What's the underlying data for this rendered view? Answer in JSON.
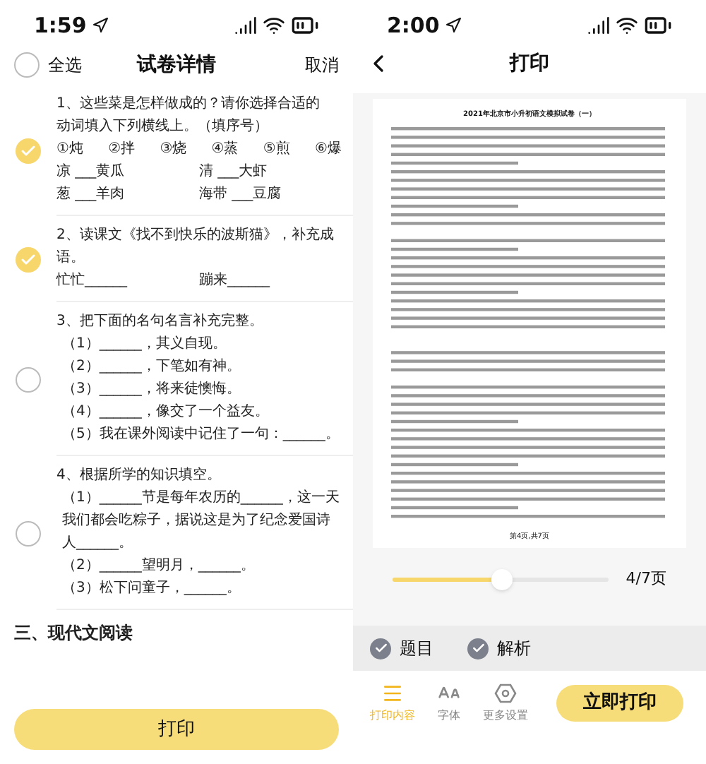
{
  "left": {
    "status_bar": {
      "time": "1:59"
    },
    "header": {
      "select_all": {
        "label": "全选",
        "checked": false
      },
      "title": "试卷详情",
      "cancel": "取消"
    },
    "questions": [
      {
        "selected": true,
        "lines": [
          {
            "kind": "text",
            "text": "1、这些菜是怎样做成的？请你选择合适的"
          },
          {
            "kind": "text",
            "text": "动词填入下列横线上。（填序号）"
          },
          {
            "kind": "cols",
            "cells": [
              "①炖",
              "②拌",
              "③烧",
              "④蒸",
              "⑤煎",
              "⑥爆"
            ]
          },
          {
            "kind": "cols",
            "cells": [
              "凉 ___黄瓜",
              "清 ___大虾"
            ]
          },
          {
            "kind": "cols",
            "cells": [
              "葱 ___羊肉",
              "海带 ___豆腐"
            ]
          }
        ]
      },
      {
        "selected": true,
        "lines": [
          {
            "kind": "text",
            "text": "2、读课文《找不到快乐的波斯猫》，补充成语。"
          },
          {
            "kind": "cols",
            "cells": [
              "忙忙______",
              "蹦来______"
            ]
          }
        ]
      },
      {
        "selected": false,
        "lines": [
          {
            "kind": "text",
            "text": "3、把下面的名句名言补充完整。"
          },
          {
            "kind": "sub",
            "text": "（1）______，其义自现。"
          },
          {
            "kind": "sub",
            "text": "（2）______，下笔如有神。"
          },
          {
            "kind": "sub",
            "text": "（3）______，将来徒懊悔。"
          },
          {
            "kind": "sub",
            "text": "（4）______，像交了一个益友。"
          },
          {
            "kind": "sub",
            "text": "（5）我在课外阅读中记住了一句：______。"
          }
        ]
      },
      {
        "selected": false,
        "lines": [
          {
            "kind": "text",
            "text": "4、根据所学的知识填空。"
          },
          {
            "kind": "sub",
            "text": "（1）______节是每年农历的______，这一天我们都会吃粽子，据说这是为了纪念爱国诗人______。"
          },
          {
            "kind": "sub",
            "text": "（2）______望明月，______。"
          },
          {
            "kind": "sub",
            "text": "（3）松下问童子，______。"
          }
        ]
      }
    ],
    "section": "三、现代文阅读",
    "print_button": "打印"
  },
  "right": {
    "status_bar": {
      "time": "2:00"
    },
    "nav": {
      "title": "打印"
    },
    "preview": {
      "title": "2021年北京市小升初语文模拟试卷（一）",
      "footer": "第4页,共7页"
    },
    "pager": {
      "level": 0.5,
      "reading": "4/7页"
    },
    "options": [
      {
        "label": "题目",
        "checked": true
      },
      {
        "label": "解析",
        "checked": true
      }
    ],
    "tabs": [
      {
        "kind": "content",
        "label": "打印内容",
        "selected": true
      },
      {
        "kind": "font",
        "label": "字体",
        "selected": false
      },
      {
        "kind": "settings",
        "label": "更多设置",
        "selected": false
      }
    ],
    "print_now": "立即打印"
  }
}
